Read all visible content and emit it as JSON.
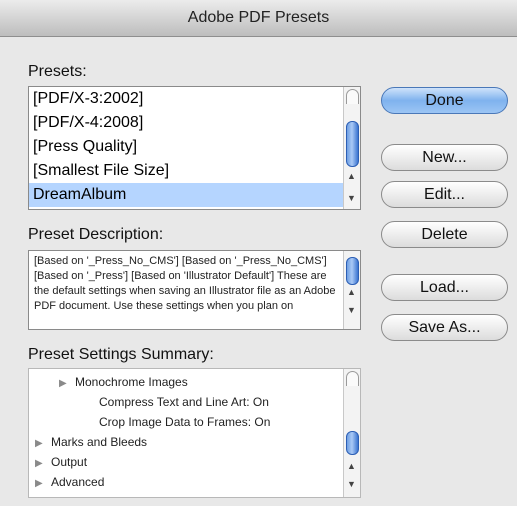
{
  "window": {
    "title": "Adobe PDF Presets"
  },
  "presets": {
    "label": "Presets:",
    "items": [
      {
        "label": "[PDF/X-3:2002]",
        "selected": false
      },
      {
        "label": "[PDF/X-4:2008]",
        "selected": false
      },
      {
        "label": "[Press Quality]",
        "selected": false
      },
      {
        "label": "[Smallest File Size]",
        "selected": false
      },
      {
        "label": "DreamAlbum",
        "selected": true
      }
    ]
  },
  "description": {
    "label": "Preset Description:",
    "text": "[Based on '_Press_No_CMS'] [Based on '_Press_No_CMS'] [Based on '_Press'] [Based on 'Illustrator Default'] These are the default settings when saving an Illustrator file as an Adobe PDF document. Use these settings when you plan on"
  },
  "summary": {
    "label": "Preset Settings Summary:",
    "items": [
      {
        "label": "Monochrome Images",
        "indent": 1,
        "triangle": true
      },
      {
        "label": "Compress Text and Line Art: On",
        "indent": 2,
        "triangle": false
      },
      {
        "label": "Crop Image Data to Frames: On",
        "indent": 2,
        "triangle": false
      },
      {
        "label": "Marks and Bleeds",
        "indent": 0,
        "triangle": true
      },
      {
        "label": "Output",
        "indent": 0,
        "triangle": true
      },
      {
        "label": "Advanced",
        "indent": 0,
        "triangle": true
      }
    ]
  },
  "buttons": {
    "done": "Done",
    "new": "New...",
    "edit": "Edit...",
    "delete": "Delete",
    "load": "Load...",
    "save_as": "Save As..."
  },
  "colors": {
    "selection": "#b5d5ff",
    "default_button": "#7fb2ee"
  }
}
